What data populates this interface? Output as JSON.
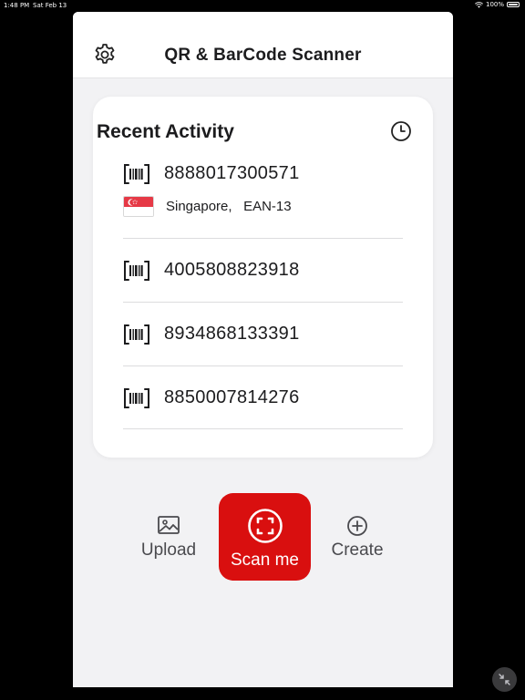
{
  "status_bar": {
    "time": "1:48 PM",
    "date": "Sat Feb 13",
    "battery": "100%"
  },
  "header": {
    "title": "QR & BarCode Scanner"
  },
  "recent": {
    "title": "Recent Activity",
    "items": [
      {
        "code": "8888017300571",
        "country": "Singapore,",
        "format": "EAN-13"
      },
      {
        "code": "4005808823918"
      },
      {
        "code": "8934868133391"
      },
      {
        "code": "8850007814276"
      }
    ]
  },
  "actions": {
    "upload": "Upload",
    "scan": "Scan me",
    "create": "Create"
  },
  "colors": {
    "accent": "#d90f0f",
    "background": "#f2f2f4",
    "card": "#ffffff"
  },
  "icons": {
    "settings": "gear-icon",
    "history": "clock-icon",
    "barcode": "barcode-icon",
    "upload": "image-icon",
    "scan": "scan-frame-icon",
    "create": "plus-circle-icon",
    "shrink": "collapse-arrows-icon"
  }
}
